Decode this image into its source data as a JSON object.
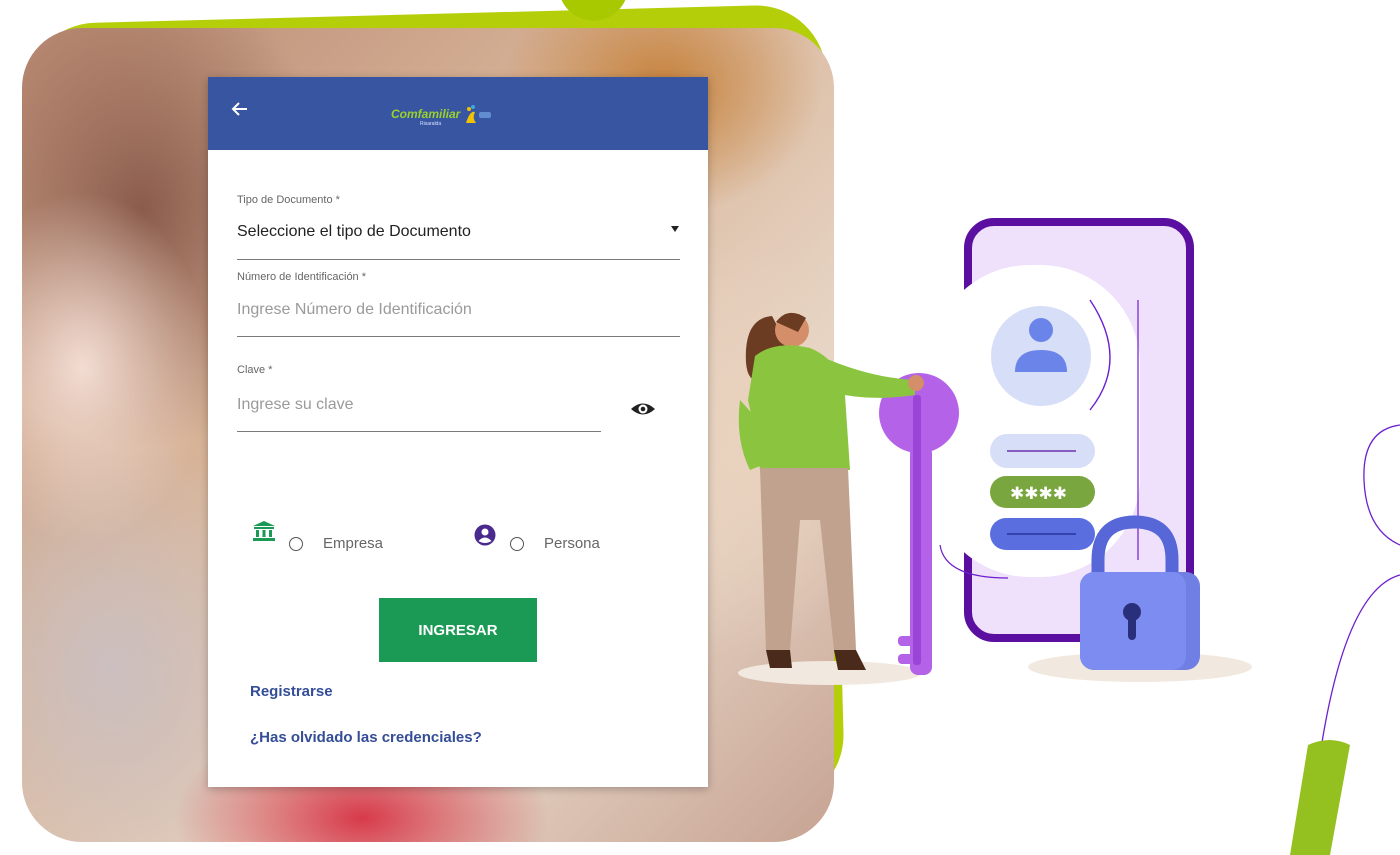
{
  "header": {
    "back_icon": "arrow-left-icon",
    "logo_text": "Comfamiliar",
    "logo_subtext": "Risaralda",
    "color": "#3855a2"
  },
  "form": {
    "tipo_documento": {
      "label": "Tipo de Documento *",
      "value": "Seleccione el tipo de Documento",
      "caret_icon": "caret-down-icon"
    },
    "numero_id": {
      "label": "Número de Identificación *",
      "placeholder": "Ingrese Número de Identificación"
    },
    "clave": {
      "label": "Clave *",
      "placeholder": "Ingrese su clave",
      "toggle_icon": "eye-icon"
    },
    "roles": [
      {
        "icon": "bank-icon",
        "label": "Empresa",
        "selected": false
      },
      {
        "icon": "user-circle-icon",
        "label": "Persona",
        "selected": false
      }
    ],
    "submit_label": "INGRESAR",
    "submit_color": "#1a9a55"
  },
  "links": {
    "register": "Registrarse",
    "forgot": "¿Has olvidado las credenciales?"
  },
  "illustration": {
    "password_mask": "✱✱✱✱",
    "accent_color": "#b4cf0a"
  }
}
